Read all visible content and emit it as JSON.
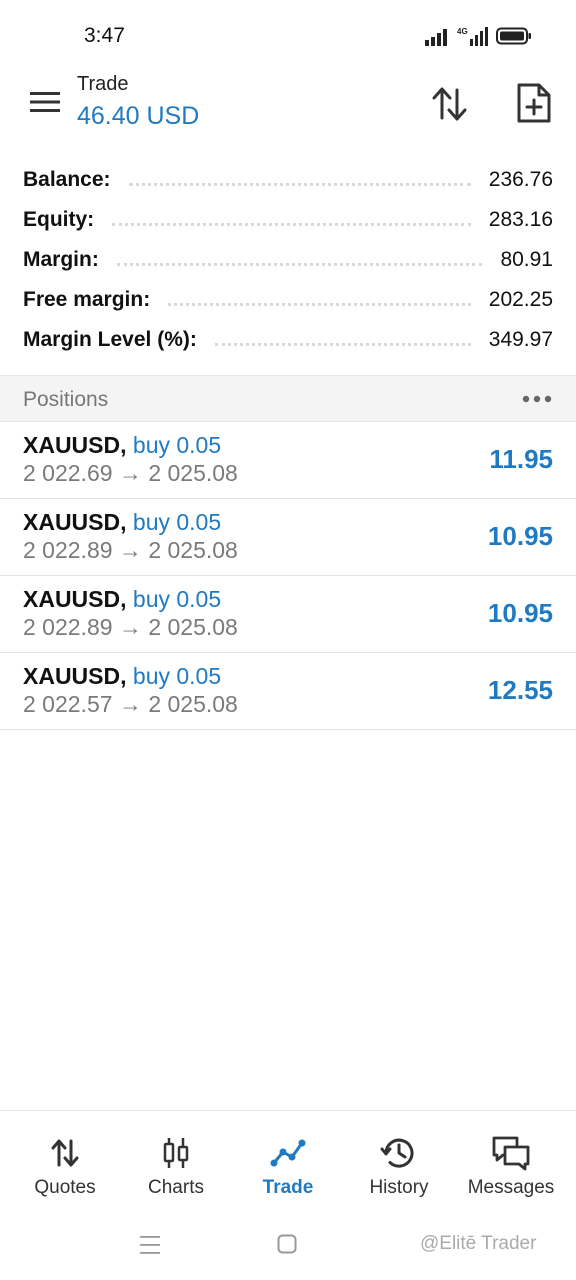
{
  "status_bar": {
    "time": "3:47",
    "network_label": "4G"
  },
  "header": {
    "title": "Trade",
    "value": "46.40 USD"
  },
  "summary": [
    {
      "label": "Balance:",
      "value": "236.76"
    },
    {
      "label": "Equity:",
      "value": "283.16"
    },
    {
      "label": "Margin:",
      "value": "80.91"
    },
    {
      "label": "Free margin:",
      "value": "202.25"
    },
    {
      "label": "Margin Level (%):",
      "value": "349.97"
    }
  ],
  "positions": {
    "title": "Positions",
    "items": [
      {
        "symbol": "XAUUSD,",
        "side": "buy 0.05",
        "open_price": "2 022.69",
        "arrow": "→",
        "current_price": "2 025.08",
        "profit": "11.95"
      },
      {
        "symbol": "XAUUSD,",
        "side": "buy 0.05",
        "open_price": "2 022.89",
        "arrow": "→",
        "current_price": "2 025.08",
        "profit": "10.95"
      },
      {
        "symbol": "XAUUSD,",
        "side": "buy 0.05",
        "open_price": "2 022.89",
        "arrow": "→",
        "current_price": "2 025.08",
        "profit": "10.95"
      },
      {
        "symbol": "XAUUSD,",
        "side": "buy 0.05",
        "open_price": "2 022.57",
        "arrow": "→",
        "current_price": "2 025.08",
        "profit": "12.55"
      }
    ]
  },
  "bottom_nav": [
    {
      "label": "Quotes",
      "icon": "quotes-icon",
      "active": false
    },
    {
      "label": "Charts",
      "icon": "charts-icon",
      "active": false
    },
    {
      "label": "Trade",
      "icon": "trade-icon",
      "active": true
    },
    {
      "label": "History",
      "icon": "history-icon",
      "active": false
    },
    {
      "label": "Messages",
      "icon": "messages-icon",
      "active": false
    }
  ],
  "watermark": "@Elitē Trader",
  "colors": {
    "accent": "#1f7ac2",
    "muted_text": "#7a7a7a",
    "section_bg": "#f4f4f4"
  }
}
